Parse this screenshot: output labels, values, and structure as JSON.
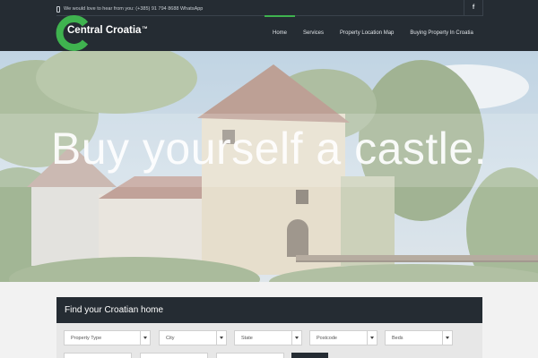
{
  "header": {
    "contact_text": "We would love to hear from you: (+385) 91 794 8688 WhatsApp",
    "facebook_label": "f",
    "logo_text": "Central Croatia",
    "logo_tm": "TM",
    "nav": [
      {
        "label": "Home",
        "active": true
      },
      {
        "label": "Services",
        "active": false
      },
      {
        "label": "Property Location Map",
        "active": false
      },
      {
        "label": "Buying Property In Croatia",
        "active": false
      }
    ]
  },
  "hero": {
    "title": "Buy yourself a castle."
  },
  "search": {
    "heading": "Find your Croatian home",
    "filters": [
      {
        "label": "Property Type"
      },
      {
        "label": "City"
      },
      {
        "label": "State"
      },
      {
        "label": "Postcode"
      },
      {
        "label": "Beds"
      }
    ]
  },
  "colors": {
    "header_bg": "#252c33",
    "accent_green": "#3fb34f"
  }
}
